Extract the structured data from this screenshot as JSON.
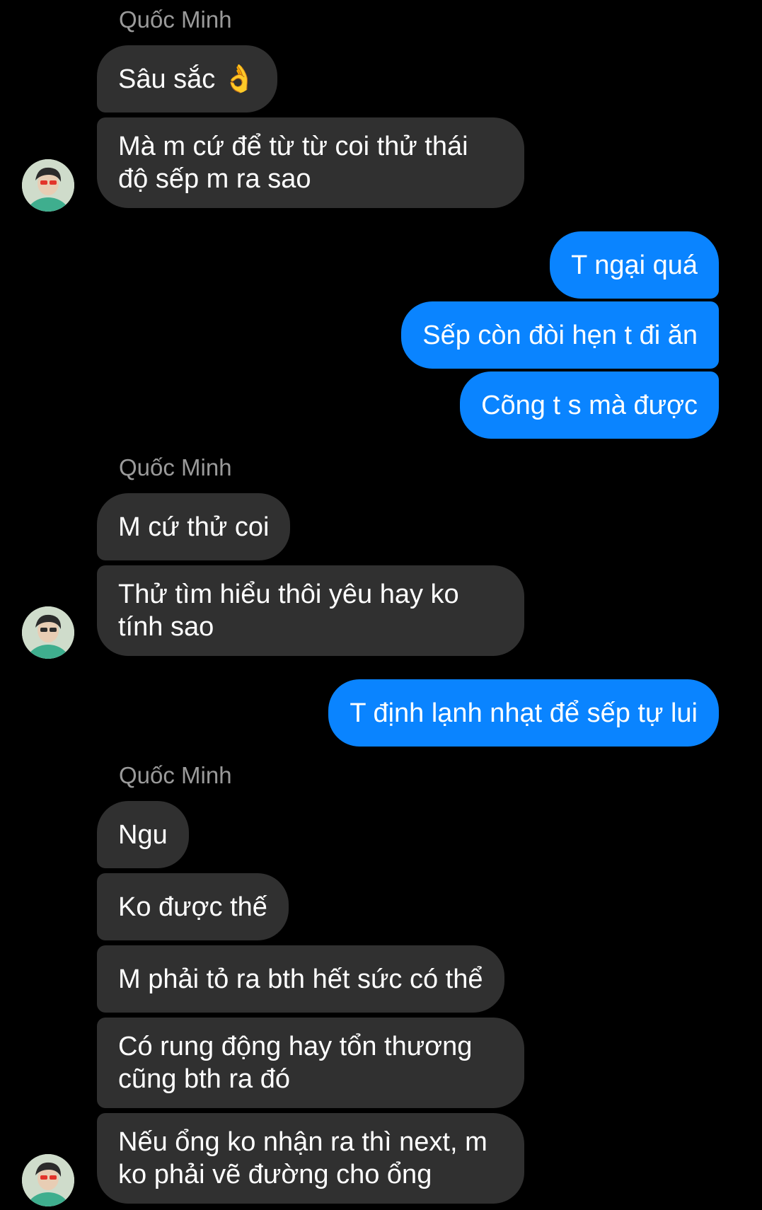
{
  "colors": {
    "background": "#000000",
    "incoming_bubble": "#303030",
    "outgoing_bubble": "#0a84ff",
    "sender_name": "#9a9a9a"
  },
  "conversation": {
    "groups": [
      {
        "sender": "Quốc Minh",
        "direction": "incoming",
        "messages": [
          "Sâu sắc 👌",
          "Mà m cứ để từ từ coi thử thái độ sếp m ra sao"
        ]
      },
      {
        "direction": "outgoing",
        "messages": [
          "T ngại quá",
          "Sếp còn đòi hẹn t đi ăn",
          "Cõng t s mà được"
        ]
      },
      {
        "sender": "Quốc Minh",
        "direction": "incoming",
        "messages": [
          "M cứ thử coi",
          "Thử tìm hiểu thôi yêu hay ko tính sao"
        ]
      },
      {
        "direction": "outgoing",
        "messages": [
          "T định lạnh nhạt để sếp tự lui"
        ]
      },
      {
        "sender": "Quốc Minh",
        "direction": "incoming",
        "messages": [
          "Ngu",
          "Ko được thế",
          "M phải tỏ ra bth hết sức có thể",
          "Có rung động hay tổn thương cũng bth ra đó",
          "Nếu ổng ko nhận ra thì next, m ko phải vẽ đường cho ổng"
        ]
      }
    ]
  },
  "avatar_icon": "user-avatar-photo"
}
